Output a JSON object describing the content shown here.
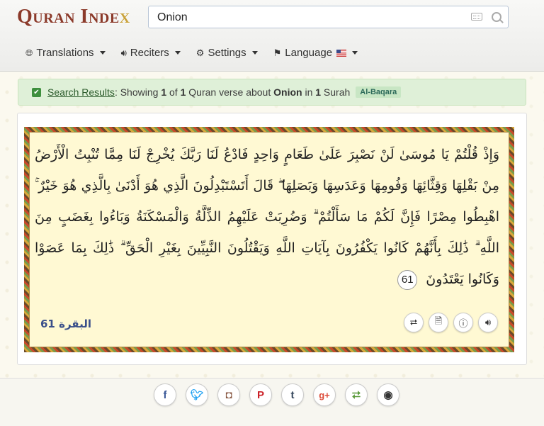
{
  "header": {
    "logo_main": "Quran Inde",
    "logo_x": "x",
    "search_value": "Onion"
  },
  "nav": {
    "translations": "Translations",
    "reciters": "Reciters",
    "settings": "Settings",
    "language": "Language"
  },
  "alert": {
    "link": "Search Results",
    "text1": ": Showing ",
    "count": "1",
    "text2": " of ",
    "total": "1",
    "text3": " Quran verse about ",
    "term": "Onion",
    "text4": " in ",
    "surah_count": "1",
    "text5": " Surah",
    "badge": "Al-Baqara"
  },
  "verse": {
    "text": "وَإِذْ قُلْتُمْ يَا مُوسَىٰ لَنْ نَصْبِرَ عَلَىٰ طَعَامٍ وَاحِدٍ فَادْعُ لَنَا رَبَّكَ يُخْرِجْ لَنَا مِمَّا تُنْبِتُ الْأَرْضُ مِنْ بَقْلِهَا وَقِثَّائِهَا وَفُومِهَا وَعَدَسِهَا وَبَصَلِهَا ۖ قَالَ أَتَسْتَبْدِلُونَ الَّذِي هُوَ أَدْنَىٰ بِالَّذِي هُوَ خَيْرٌ ۚ اهْبِطُوا مِصْرًا فَإِنَّ لَكُمْ مَا سَأَلْتُمْ ۗ وَضُرِبَتْ عَلَيْهِمُ الذِّلَّةُ وَالْمَسْكَنَةُ وَبَاءُوا بِغَضَبٍ مِنَ اللَّهِ ۗ ذَٰلِكَ بِأَنَّهُمْ كَانُوا يَكْفُرُونَ بِآيَاتِ اللَّهِ وَيَقْتُلُونَ النَّبِيِّينَ بِغَيْرِ الْحَقِّ ۗ ذَٰلِكَ بِمَا عَصَوْا وَكَانُوا يَعْتَدُونَ",
    "number": "61",
    "reference": "البقرة 61"
  },
  "icons": {
    "share": "share-icon",
    "pdf": "pdf-icon",
    "info": "info-icon",
    "audio": "speaker-icon"
  },
  "social": [
    "f",
    "t",
    "◘",
    "P",
    "t",
    "g+",
    "<",
    "◉"
  ],
  "colors": {
    "logo": "#8b3a2a",
    "alert_bg": "#dff0d8",
    "verse_bg": "#fff9d3",
    "reference": "#3a4f8a"
  }
}
